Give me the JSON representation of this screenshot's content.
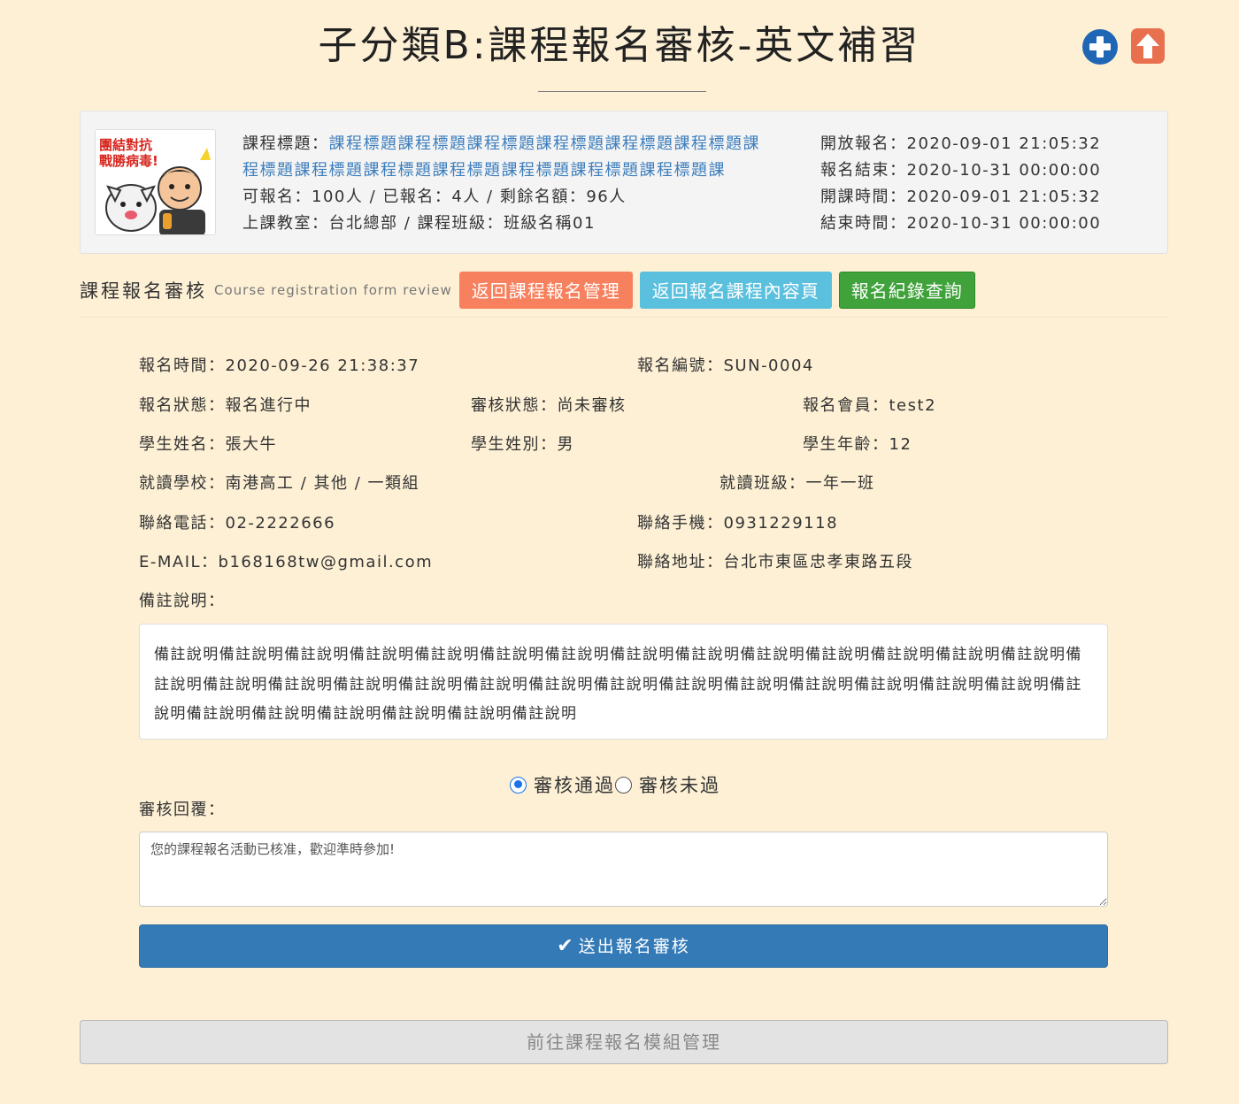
{
  "page": {
    "title": "子分類B:課程報名審核-英文補習"
  },
  "top_icons": [
    "plus-circle-icon",
    "upload-arrow-icon"
  ],
  "course_info": {
    "thumb_caption": "團結對抗 戰勝病毒!",
    "title_label": "課程標題：",
    "title_value": "課程標題課程標題課程標題課程標題課程標題課程標題課程標題課程標題課程標題課程標題課程標題課程標題課程標題課",
    "capacity_line": "可報名：100人 / 已報名：4人 / 剩餘名額：96人",
    "location_line": "上課教室：台北總部 / 課程班級：班級名稱01",
    "open_reg": "開放報名：2020-09-01 21:05:32",
    "close_reg": "報名結束：2020-10-31 00:00:00",
    "course_start": "開課時間：2020-09-01 21:05:32",
    "course_end": "結束時間：2020-10-31 00:00:00"
  },
  "section": {
    "title": "課程報名審核",
    "subtitle": "Course registration form review",
    "btn_back_manage": "返回課程報名管理",
    "btn_back_content": "返回報名課程內容頁",
    "btn_records": "報名紀錄查詢"
  },
  "fields": {
    "reg_time": "報名時間：2020-09-26 21:38:37",
    "reg_no": "報名編號：SUN-0004",
    "reg_status": "報名狀態：報名進行中",
    "review_status": "審核狀態：尚未審核",
    "member": "報名會員：test2",
    "student_name": "學生姓名：張大牛",
    "student_gender": "學生姓別：男",
    "student_age": "學生年齡：12",
    "school": "就讀學校：南港高工 / 其他 / 一類組",
    "class": "就讀班級：一年一班",
    "phone": "聯絡電話：02-2222666",
    "mobile": "聯絡手機：0931229118",
    "email": "E-MAIL：b168168tw@gmail.com",
    "address": "聯絡地址：台北市東區忠孝東路五段",
    "memo_label": "備註說明：",
    "memo_text": "備註說明備註說明備註說明備註說明備註說明備註說明備註說明備註說明備註說明備註說明備註說明備註說明備註說明備註說明備註說明備註說明備註說明備註說明備註說明備註說明備註說明備註說明備註說明備註說明備註說明備註說明備註說明備註說明備註說明備註說明備註說明備註說明備註說明備註說明備註說明"
  },
  "review": {
    "pass_label": "審核通過",
    "fail_label": "審核未過",
    "reply_label": "審核回覆：",
    "reply_value": "您的課程報名活動已核准，歡迎準時參加!",
    "submit_label": "送出報名審核",
    "module_btn": "前往課程報名模組管理"
  },
  "colors": {
    "background": "#fdf0d5",
    "link": "#3d7ebd",
    "btn_orange": "#f7805e",
    "btn_blue": "#5bc0de",
    "btn_green": "#3fa23a",
    "submit": "#337ab7",
    "icon_plus": "#1f66b5",
    "icon_upload": "#e8704f"
  }
}
